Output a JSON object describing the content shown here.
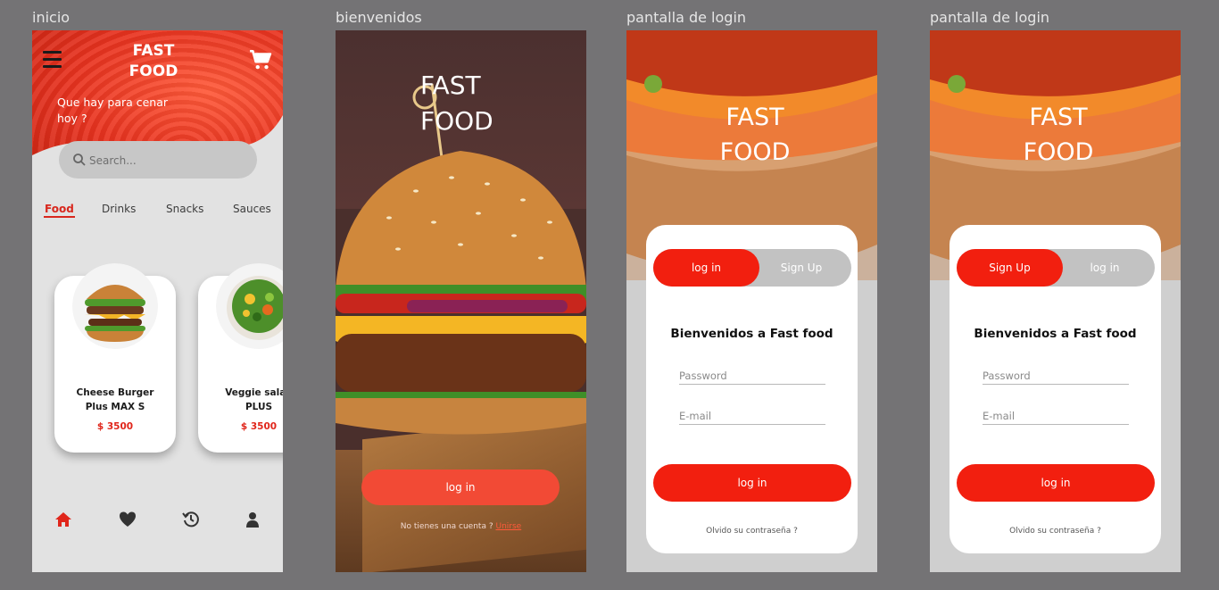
{
  "labels": {
    "inicio": "inicio",
    "bienvenidos": "bienvenidos",
    "login1": "pantalla de login",
    "login2": "pantalla de login"
  },
  "inicio": {
    "title": "FAST\nFOOD",
    "subtitle": "Que hay para cenar hoy ?",
    "search_placeholder": "Search...",
    "tabs": [
      {
        "label": "Food",
        "active": true
      },
      {
        "label": "Drinks",
        "active": false
      },
      {
        "label": "Snacks",
        "active": false
      },
      {
        "label": "Sauces",
        "active": false
      }
    ],
    "cards": [
      {
        "name": "Cheese Burger Plus MAX S",
        "price": "$ 3500",
        "image": "burger"
      },
      {
        "name": "Veggie salad PLUS",
        "price": "$ 3500",
        "image": "salad"
      }
    ],
    "nav": [
      {
        "icon": "home-icon",
        "active": true
      },
      {
        "icon": "heart-icon",
        "active": false
      },
      {
        "icon": "history-icon",
        "active": false
      },
      {
        "icon": "user-icon",
        "active": false
      }
    ],
    "accent": "#e0261b"
  },
  "bienvenidos": {
    "title": "FAST\nFOOD",
    "button": "log in",
    "footer_text": "No tienes una cuenta ?",
    "footer_link": "Unirse"
  },
  "login1": {
    "title": "FAST\nFOOD",
    "toggle_left": "log in",
    "toggle_right": "Sign Up",
    "welcome": "Bienvenidos a Fast food",
    "password_placeholder": "Password",
    "email_placeholder": "E-mail",
    "button": "log in",
    "forgot": "Olvido su contraseña ?"
  },
  "login2": {
    "title": "FAST\nFOOD",
    "toggle_left": "Sign Up",
    "toggle_right": "log in",
    "welcome": "Bienvenidos a Fast food",
    "password_placeholder": "Password",
    "email_placeholder": "E-mail",
    "button": "log in",
    "forgot": "Olvido su contraseña ?"
  },
  "colors": {
    "primary": "#f21f0f",
    "button_soft": "#f24a35",
    "canvas": "#747375"
  }
}
